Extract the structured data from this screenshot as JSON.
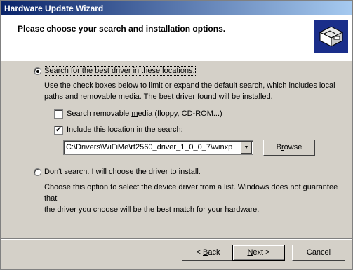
{
  "window": {
    "title": "Hardware Update Wizard"
  },
  "header": {
    "title": "Please choose your search and installation options."
  },
  "option_search": {
    "label_pre": "",
    "label_accel": "S",
    "label_post": "earch for the best driver in these locations.",
    "selected": true,
    "desc_line1": "Use the check boxes below to limit or expand the default search, which includes local",
    "desc_line2": "paths and removable media. The best driver found will be installed."
  },
  "check_removable": {
    "label_pre": "Search removable ",
    "label_accel": "m",
    "label_post": "edia (floppy, CD-ROM...)",
    "checked": false
  },
  "check_location": {
    "label_pre": "Include this ",
    "label_accel": "l",
    "label_post": "ocation in the search:",
    "checked": true
  },
  "location_combo": {
    "value": "C:\\Drivers\\WiFiMe\\rt2560_driver_1_0_0_7\\winxp"
  },
  "browse_button": {
    "label_pre": "B",
    "label_accel": "r",
    "label_post": "owse"
  },
  "option_manual": {
    "label_pre": "",
    "label_accel": "D",
    "label_post": "on't search. I will choose the driver to install.",
    "selected": false,
    "desc_line1": "Choose this option to select the device driver from a list.  Windows does not guarantee that",
    "desc_line2": "the driver you choose will be the best match for your hardware."
  },
  "footer": {
    "back": {
      "prefix": "< ",
      "accel": "B",
      "rest": "ack"
    },
    "next": {
      "accel": "N",
      "rest": "ext >"
    },
    "cancel": "Cancel"
  },
  "colors": {
    "title_start": "#0a246a",
    "title_end": "#a6caf0",
    "face": "#d4d0c8"
  },
  "icons": {
    "header": "hardware-box-icon"
  }
}
